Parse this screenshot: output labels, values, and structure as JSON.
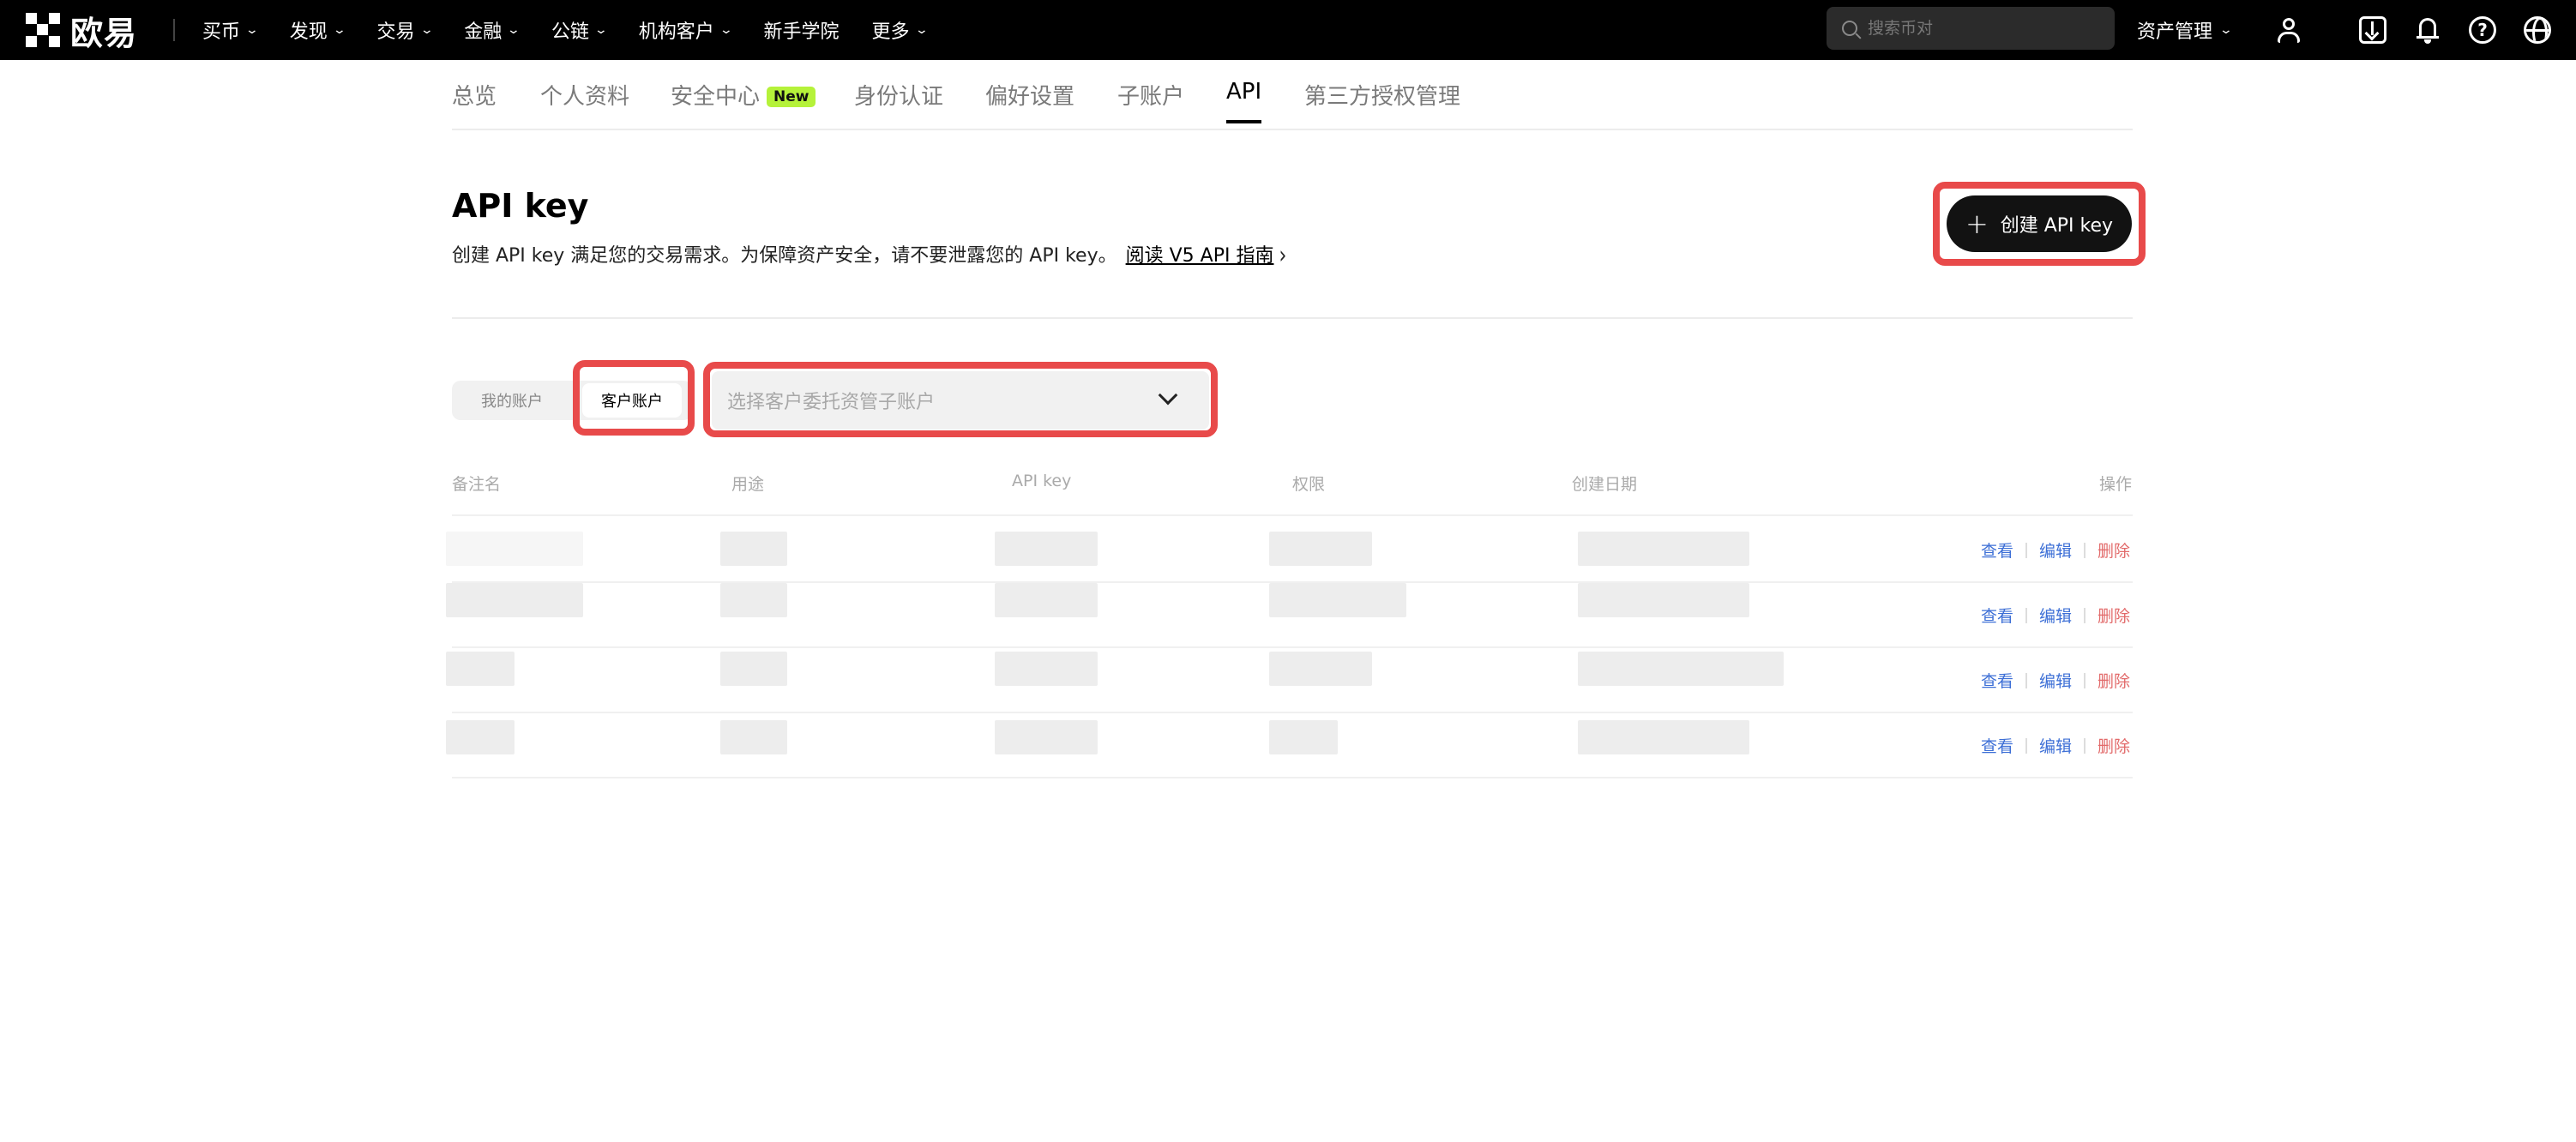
{
  "topbar": {
    "logo_text": "欧易",
    "nav": [
      {
        "label": "买币",
        "dropdown": true
      },
      {
        "label": "发现",
        "dropdown": true
      },
      {
        "label": "交易",
        "dropdown": true
      },
      {
        "label": "金融",
        "dropdown": true
      },
      {
        "label": "公链",
        "dropdown": true
      },
      {
        "label": "机构客户",
        "dropdown": true
      },
      {
        "label": "新手学院",
        "dropdown": false
      },
      {
        "label": "更多",
        "dropdown": true
      }
    ],
    "search_placeholder": "搜索币对",
    "asset_menu": "资产管理"
  },
  "tabs": [
    {
      "label": "总览"
    },
    {
      "label": "个人资料"
    },
    {
      "label": "安全中心",
      "badge": "New"
    },
    {
      "label": "身份认证"
    },
    {
      "label": "偏好设置"
    },
    {
      "label": "子账户"
    },
    {
      "label": "API",
      "active": true
    },
    {
      "label": "第三方授权管理"
    }
  ],
  "header": {
    "title": "API key",
    "description": "创建 API key 满足您的交易需求。为保障资产安全，请不要泄露您的 API key。",
    "guide_link": "阅读 V5 API 指南",
    "create_button": "创建 API key"
  },
  "filter": {
    "segments": [
      "我的账户",
      "客户账户"
    ],
    "selected_segment": "客户账户",
    "select_placeholder": "选择客户委托资管子账户"
  },
  "table": {
    "columns": [
      "备注名",
      "用途",
      "API key",
      "权限",
      "创建日期",
      "操作"
    ],
    "row_actions": {
      "view": "查看",
      "edit": "编辑",
      "delete": "删除"
    },
    "row_count": 4
  },
  "colors": {
    "highlight": "#e84a4a",
    "link": "#3d6fd6",
    "delete": "#e26a6a",
    "badge": "#b5f23a"
  }
}
